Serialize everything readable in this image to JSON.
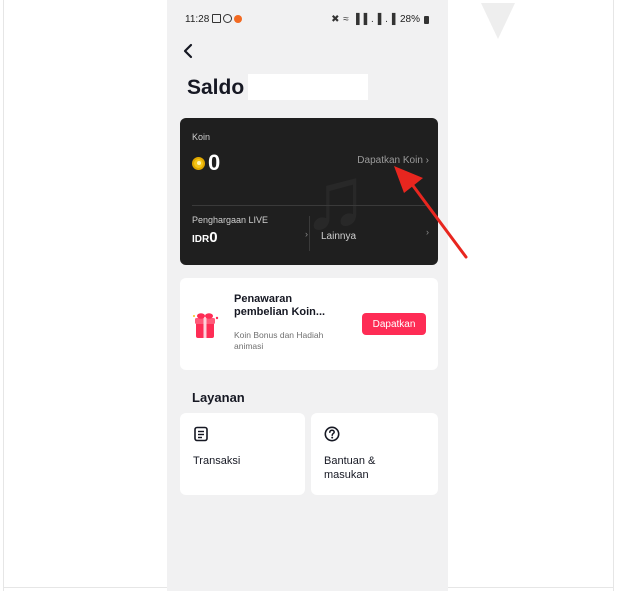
{
  "status_bar": {
    "time": "11:28",
    "signal_text": "✖ ≈ ▐▐ .▐ .▐",
    "battery": "28%"
  },
  "header": {
    "back_icon": "back-arrow-icon",
    "title": "Saldo"
  },
  "balance_card": {
    "coin_label": "Koin",
    "coin_value": "0",
    "coin_icon": "coin-icon",
    "get_coins_link": "Dapatkan Koin ›",
    "rewards_label": "Penghargaan LIVE",
    "rewards_currency": "IDR",
    "rewards_value": "0",
    "rewards_chevron": "›",
    "others_label": "Lainnya",
    "others_chevron": "›"
  },
  "offer_card": {
    "icon": "gift-icon",
    "title_line1": "Penawaran",
    "title_line2": "pembelian Koin...",
    "subtitle_line1": "Koin Bonus dan Hadiah",
    "subtitle_line2": "animasi",
    "button_label": "Dapatkan"
  },
  "services": {
    "title": "Layanan",
    "items": [
      {
        "icon": "document-icon",
        "label_line1": "Transaksi",
        "label_line2": ""
      },
      {
        "icon": "help-question-icon",
        "label_line1": "Bantuan &",
        "label_line2": "masukan"
      }
    ]
  },
  "annotation": {
    "color": "#e8261f"
  }
}
